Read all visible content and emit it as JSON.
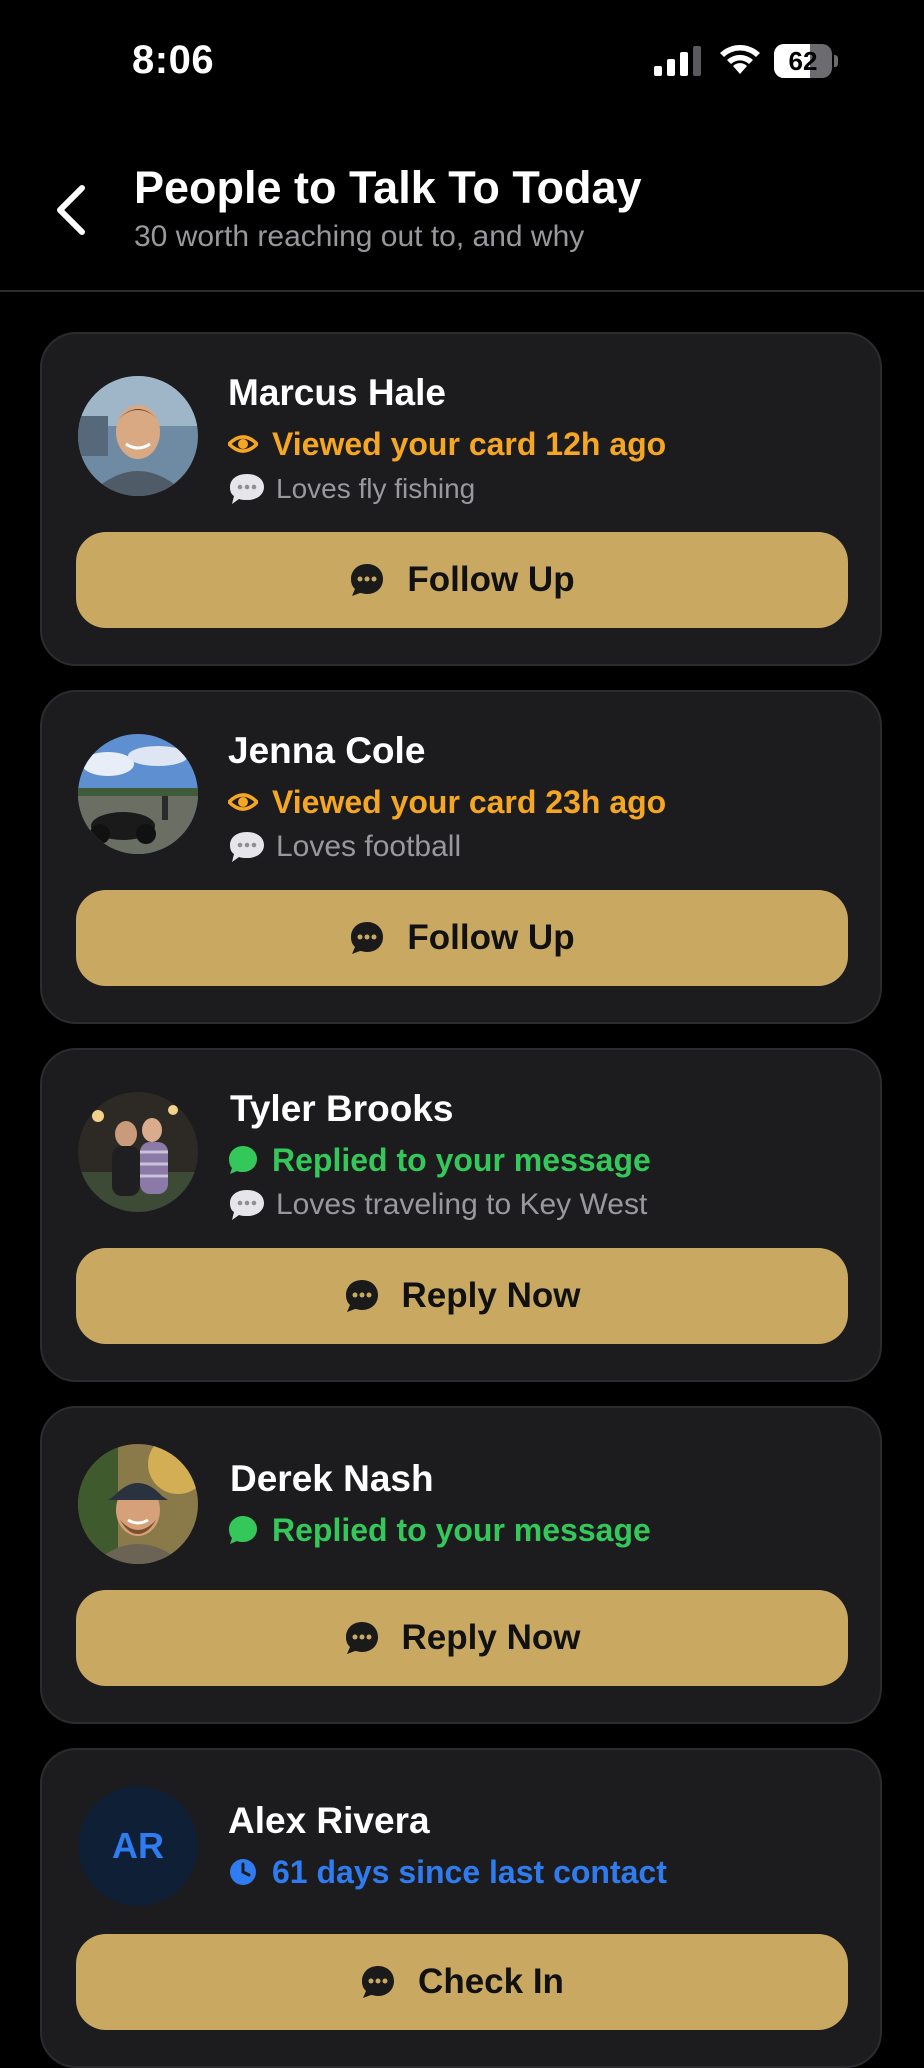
{
  "status_bar": {
    "time": "8:06",
    "battery": 62
  },
  "header": {
    "title": "People to Talk To Today",
    "subtitle": "30 worth reaching out to, and why"
  },
  "colors": {
    "accent_gold": "#c9a962",
    "viewed_orange": "#f5a623",
    "replied_green": "#34c759",
    "contact_blue": "#2f7bf0",
    "card_bg": "#1c1c1e",
    "muted_text": "#98989d"
  },
  "people": [
    {
      "name": "Marcus Hale",
      "status_icon": "eye-icon",
      "status": "Viewed your card 12h ago",
      "note": "Loves fly fishing",
      "action": "Follow Up"
    },
    {
      "name": "Jenna Cole",
      "status_icon": "eye-icon",
      "status": "Viewed your card 23h ago",
      "note": "Loves football",
      "action": "Follow Up"
    },
    {
      "name": "Tyler Brooks",
      "status_icon": "message-bubble-icon",
      "status": "Replied to your message",
      "note": "Loves traveling to Key West",
      "action": "Reply Now"
    },
    {
      "name": "Derek Nash",
      "status_icon": "message-bubble-icon",
      "status": "Replied to your message",
      "action": "Reply Now"
    },
    {
      "name": "Alex Rivera",
      "initials": "AR",
      "status_icon": "clock-icon",
      "status": "61 days since last contact",
      "action": "Check In"
    }
  ]
}
